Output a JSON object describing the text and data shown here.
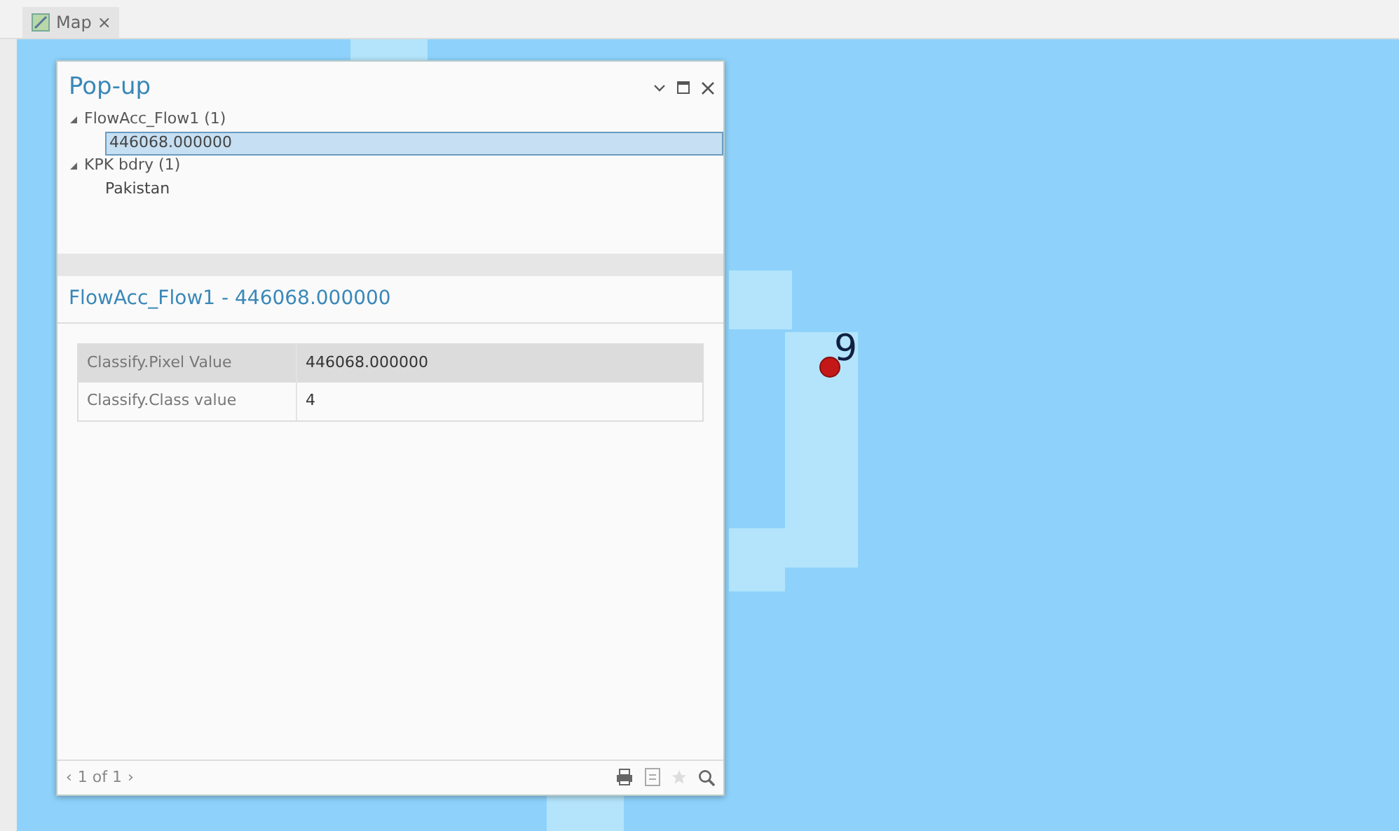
{
  "tab": {
    "label": "Map",
    "close": "×"
  },
  "map": {
    "point_label": "9"
  },
  "popup": {
    "title": "Pop-up",
    "tree": [
      {
        "label": "FlowAcc_Flow1 (1)",
        "expanded": true,
        "children": [
          {
            "label": "446068.000000",
            "selected": true
          }
        ]
      },
      {
        "label": "KPK bdry (1)",
        "expanded": true,
        "children": [
          {
            "label": "Pakistan",
            "selected": false
          }
        ]
      }
    ],
    "feature_title": "FlowAcc_Flow1 - 446068.000000",
    "fields": [
      {
        "name": "Classify.Pixel Value",
        "value": "446068.000000"
      },
      {
        "name": "Classify.Class value",
        "value": "4"
      }
    ],
    "pager": {
      "prev": "‹",
      "text": "1 of 1",
      "next": "›"
    }
  }
}
